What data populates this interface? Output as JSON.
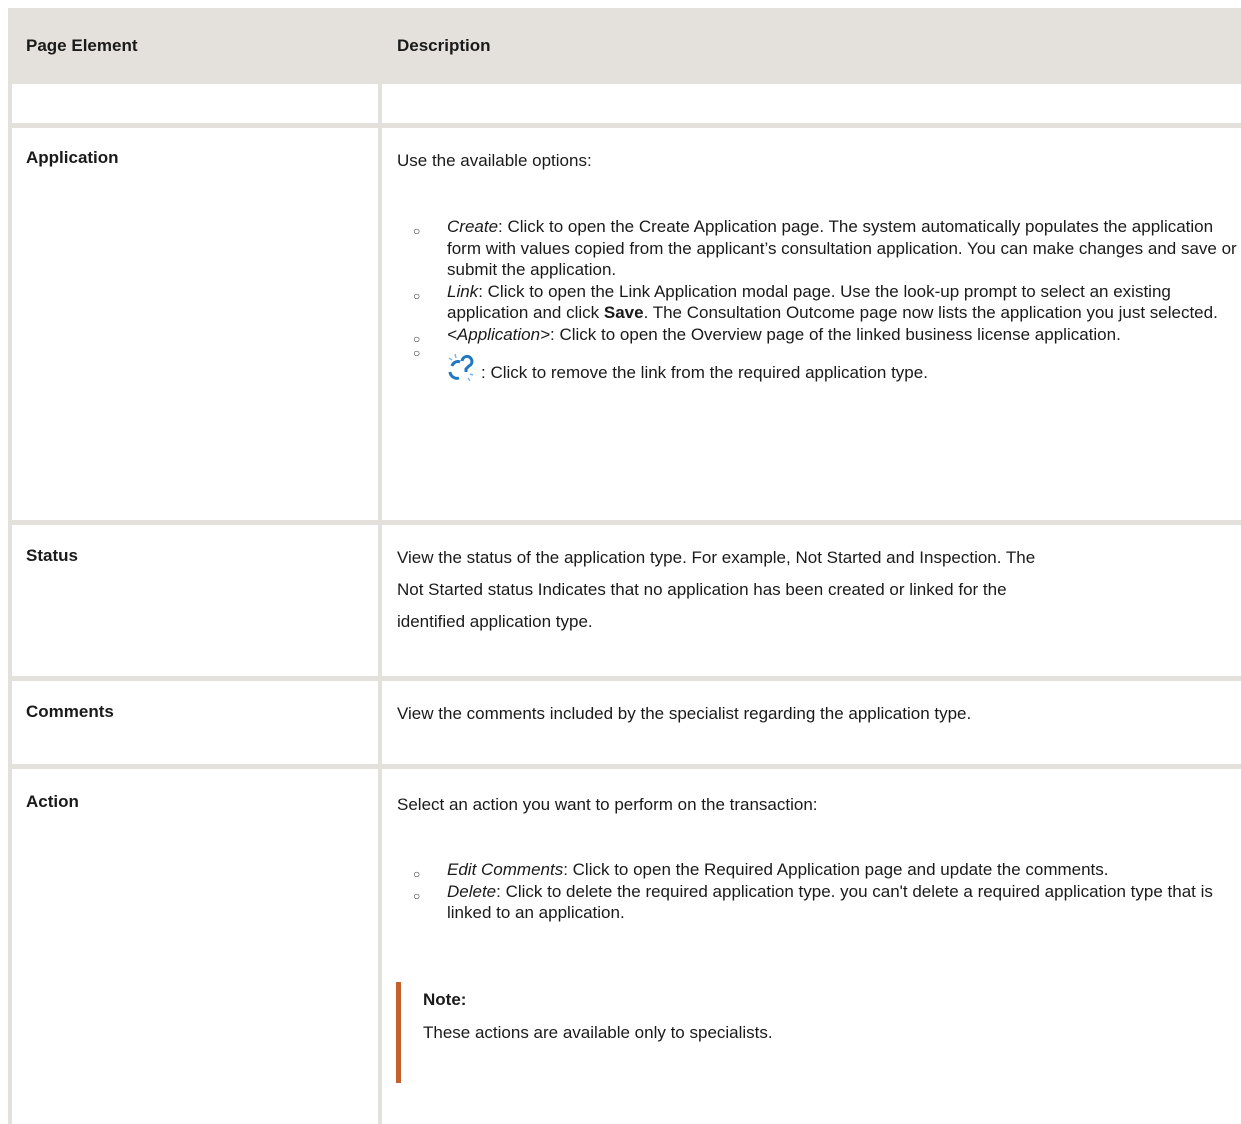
{
  "table": {
    "header": {
      "col1": "Page Element",
      "col2": "Description"
    },
    "rows": {
      "application": {
        "label": "Application",
        "intro": "Use the available options:",
        "options": {
          "create": {
            "term": "Create",
            "text": ": Click to open the Create Application page. The system automatically populates the application form with values copied from the applicant’s consultation application. You can make changes and save or submit the application."
          },
          "link": {
            "term": "Link",
            "text_before": ": Click to open the Link Application modal page. Use the look-up prompt to select an existing application and click ",
            "bold": "Save",
            "text_after": ". The Consultation Outcome page now lists the application you just selected."
          },
          "application": {
            "term": "<Application>",
            "text": ": Click to open the Overview page of the linked business license application."
          },
          "remove_link": {
            "icon": "unlink-icon",
            "text": ": Click to remove the link from the required application type."
          }
        }
      },
      "status": {
        "label": "Status",
        "lines": [
          "View the status of the application type. For example, Not Started and Inspection. The",
          "Not Started status Indicates that no application has been created or linked for the",
          "identified application type."
        ]
      },
      "comments": {
        "label": "Comments",
        "text": "View the comments included by the specialist regarding the application type."
      },
      "action": {
        "label": "Action",
        "intro": "Select an action you want to perform on the transaction:",
        "options": {
          "edit_comments": {
            "term": "Edit Comments",
            "text": ": Click to open the Required Application page and update the comments."
          },
          "delete": {
            "term": "Delete",
            "text": ": Click to delete the required application type. you can't delete a required application type that is linked to an application."
          }
        },
        "note": {
          "title": "Note:",
          "body": "These actions are available only to specialists."
        }
      }
    }
  },
  "colors": {
    "table_rule": "#e4e1dc",
    "note_accent": "#c4602b",
    "icon_blue": "#1f76c2"
  }
}
